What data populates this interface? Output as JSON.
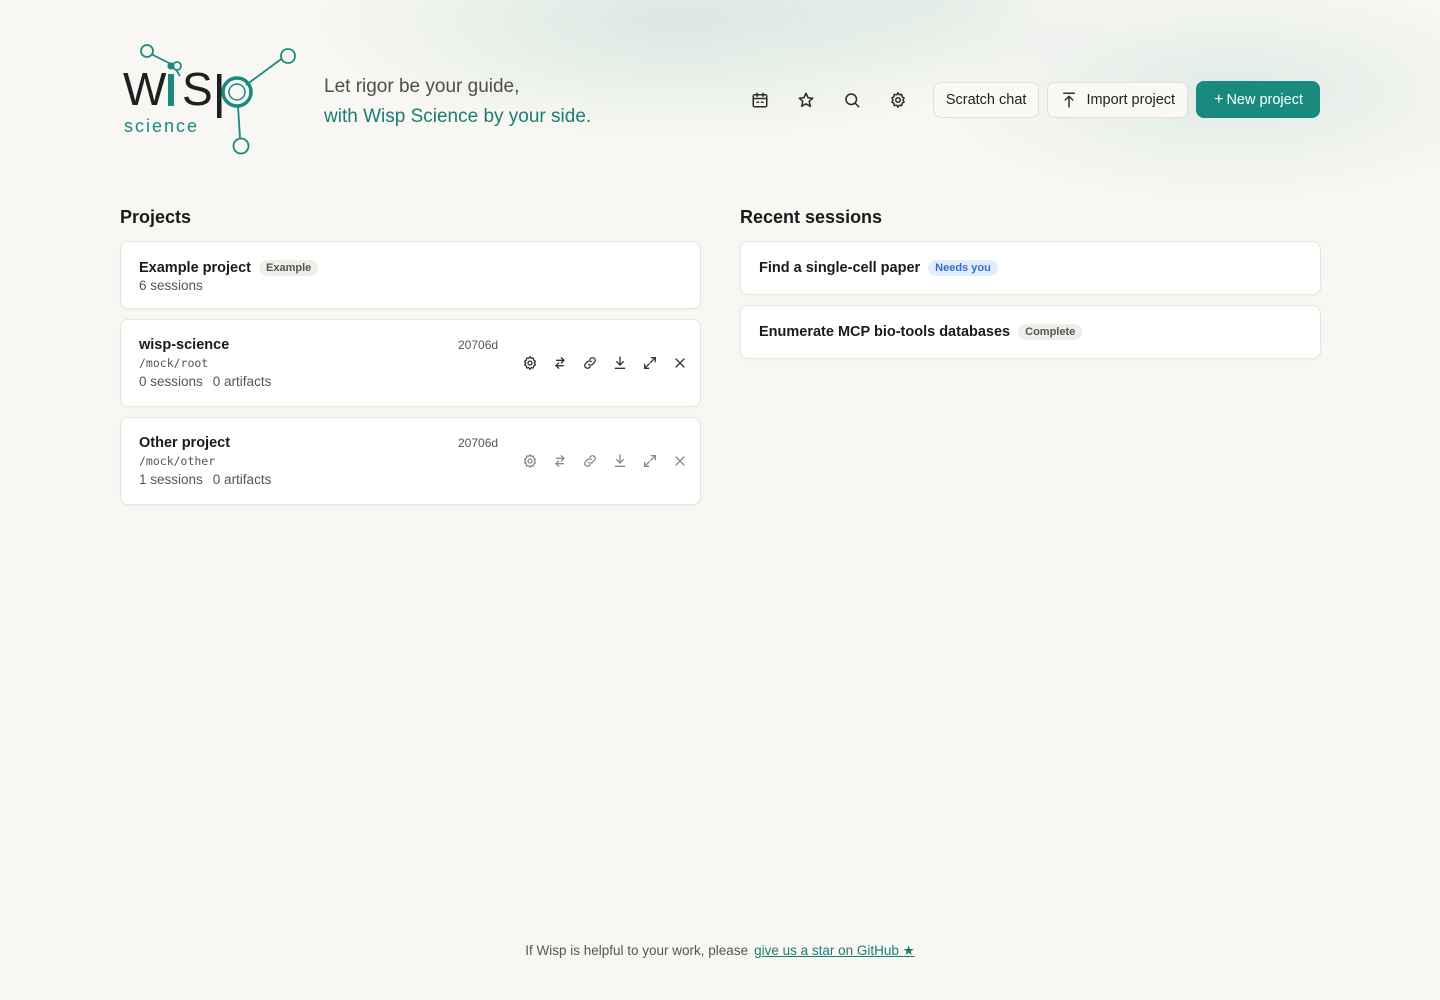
{
  "brand": {
    "logo_word": "WISP",
    "logo_sub": "science"
  },
  "tagline": {
    "line1": "Let rigor be your guide,",
    "line2": "with Wisp Science by your side."
  },
  "toolbar": {
    "icons": [
      "calendar-icon",
      "star-icon",
      "search-icon",
      "gear-icon"
    ],
    "scratch_chat": "Scratch chat",
    "import_project": "Import project",
    "new_project_plus": "+",
    "new_project": "New project"
  },
  "projects": {
    "title": "Projects",
    "example": {
      "name": "Example project",
      "badge": "Example",
      "sessions": "6 sessions"
    },
    "items": [
      {
        "name": "wisp-science",
        "path": "/mock/root",
        "age": "20706d",
        "sessions": "0 sessions",
        "artifacts": "0 artifacts"
      },
      {
        "name": "Other project",
        "path": "/mock/other",
        "age": "20706d",
        "sessions": "1 sessions",
        "artifacts": "0 artifacts"
      }
    ]
  },
  "recent": {
    "title": "Recent sessions",
    "items": [
      {
        "name": "Find a single-cell paper",
        "status": "Needs you"
      },
      {
        "name": "Enumerate MCP bio-tools databases",
        "status": "Complete"
      }
    ]
  },
  "footer": {
    "text": "If Wisp is helpful to your work, please",
    "link": "give us a star on GitHub ★"
  },
  "colors": {
    "accent": "#1a8a7f",
    "accent_text": "#1a7d73",
    "background": "#f8f7f3",
    "needs_you": "#2f6fd0"
  }
}
